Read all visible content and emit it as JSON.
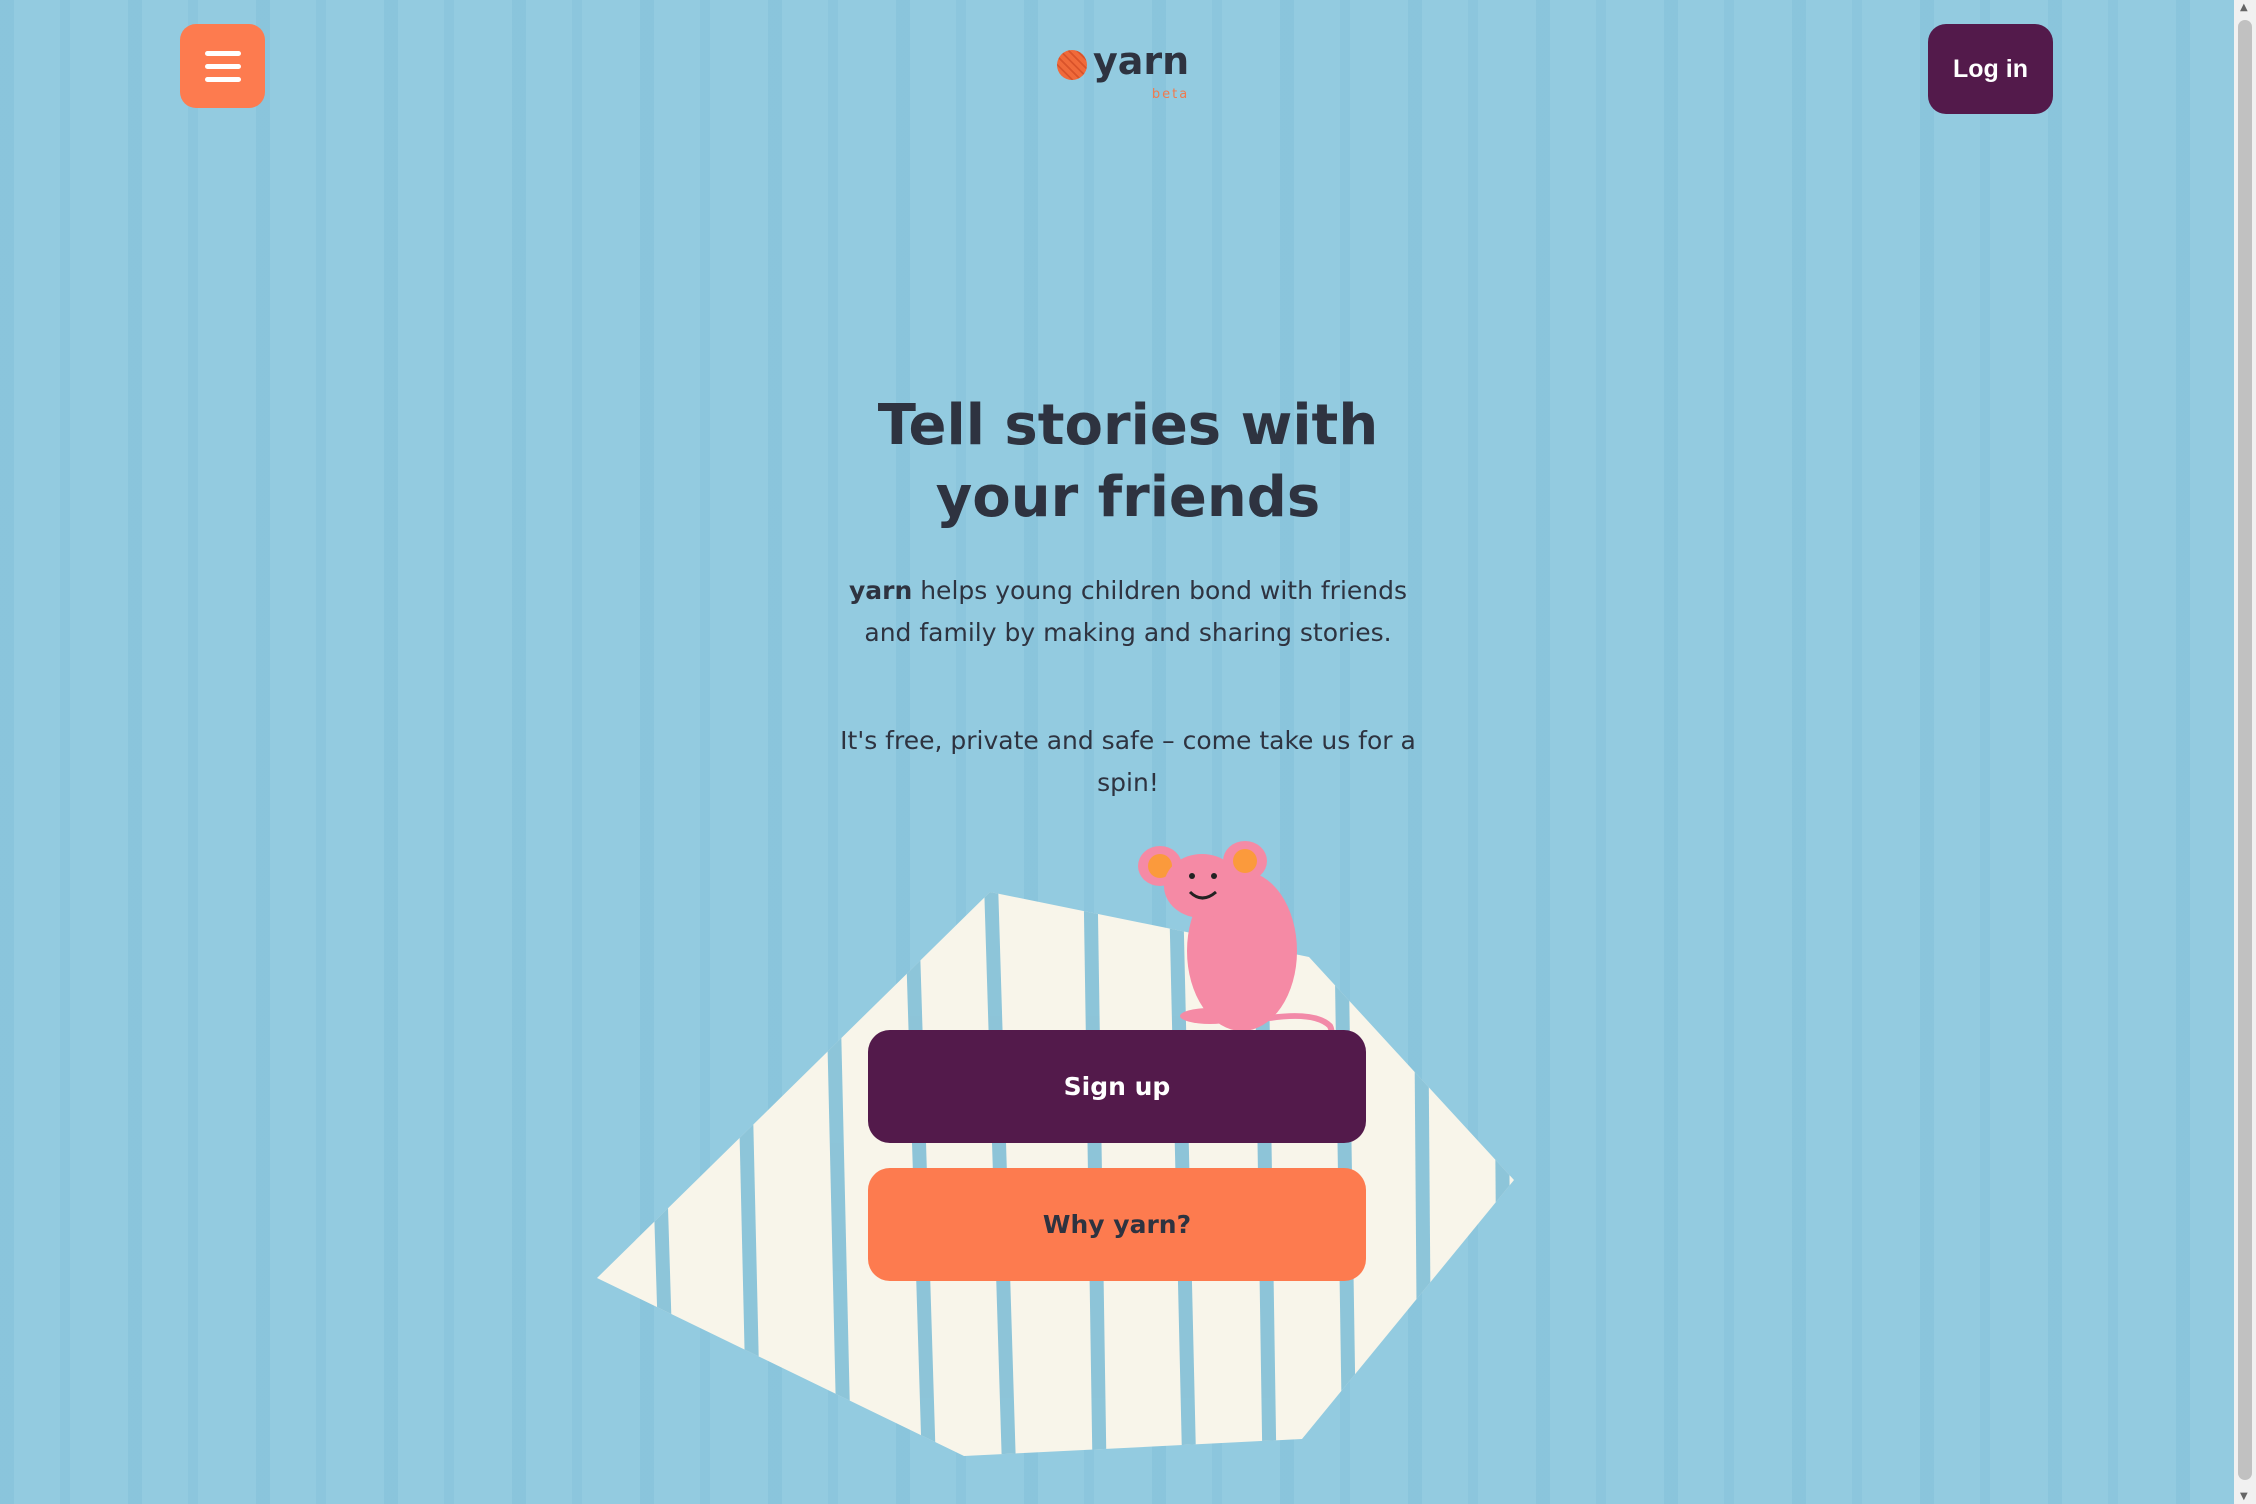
{
  "header": {
    "menu_icon": "hamburger-icon",
    "logo_text": "yarn",
    "logo_badge": "beta",
    "login_label": "Log in"
  },
  "hero": {
    "title": "Tell stories with your friends",
    "brand": "yarn",
    "description": " helps young children bond with friends and family by making and sharing stories.",
    "tagline": "It's free, private and safe – come take us for a spin!"
  },
  "actions": {
    "signup_label": "Sign up",
    "why_label": "Why yarn?"
  },
  "colors": {
    "background": "#93cbe0",
    "primary": "#531a4b",
    "accent": "#fd7b4f",
    "text": "#2e3340"
  }
}
